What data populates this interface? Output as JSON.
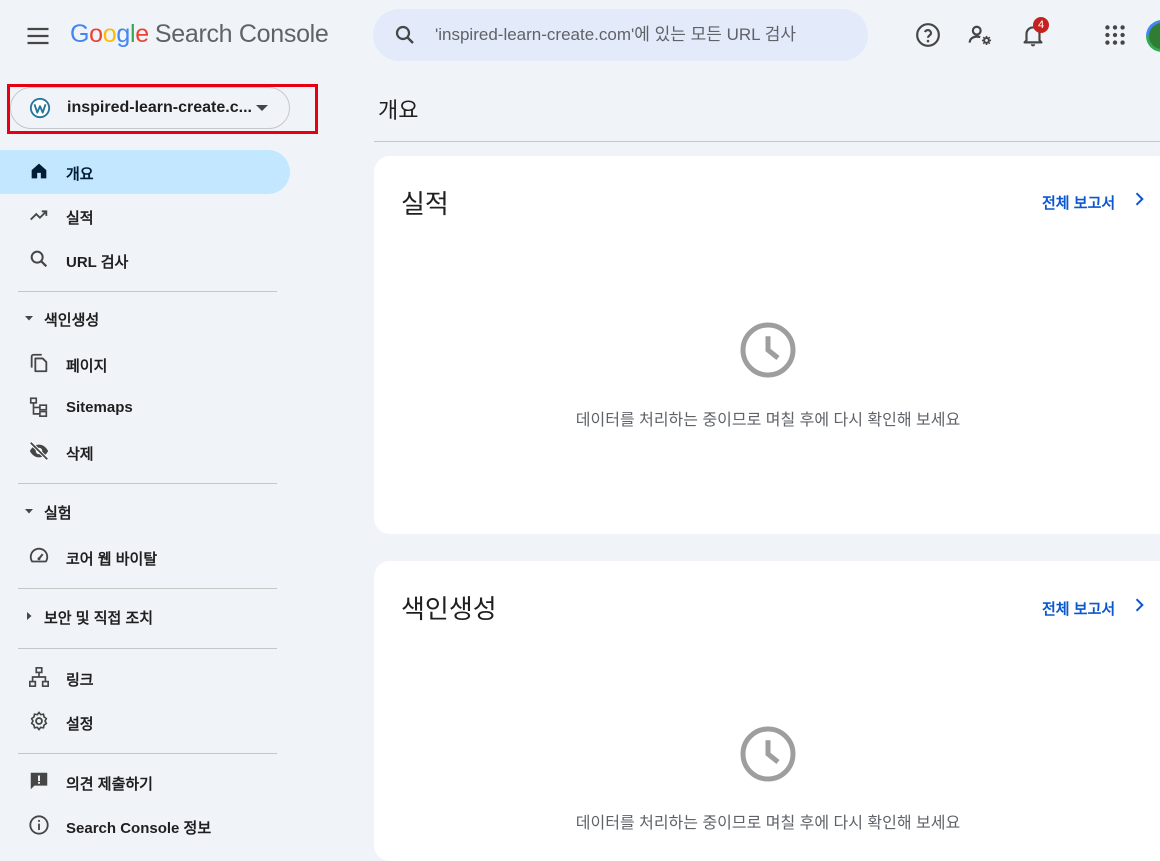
{
  "header": {
    "logo_letters": [
      "G",
      "o",
      "o",
      "g",
      "l",
      "e"
    ],
    "product": "Search Console",
    "search_placeholder": "'inspired-learn-create.com'에 있는 모든 URL 검사",
    "notification_count": "4",
    "icons": [
      "menu-icon",
      "search-icon",
      "help-icon",
      "manage-users-icon",
      "notifications-icon",
      "apps-icon",
      "account-avatar"
    ]
  },
  "property": {
    "name": "inspired-learn-create.c...",
    "icon": "wordpress-icon"
  },
  "sidebar": {
    "items": [
      {
        "label": "개요",
        "icon": "home-icon",
        "active": true
      },
      {
        "label": "실적",
        "icon": "trending-up-icon"
      },
      {
        "label": "URL 검사",
        "icon": "search-icon"
      }
    ],
    "indexing": {
      "label": "색인생성",
      "items": [
        {
          "label": "페이지",
          "icon": "pages-icon"
        },
        {
          "label": "Sitemaps",
          "icon": "sitemap-icon"
        },
        {
          "label": "삭제",
          "icon": "visibility-off-icon"
        }
      ]
    },
    "experience": {
      "label": "실험",
      "items": [
        {
          "label": "코어 웹 바이탈",
          "icon": "speed-icon"
        }
      ]
    },
    "security": {
      "label": "보안 및 직접 조치"
    },
    "misc": [
      {
        "label": "링크",
        "icon": "links-icon"
      },
      {
        "label": "설정",
        "icon": "settings-icon"
      }
    ],
    "footer": [
      {
        "label": "의견 제출하기",
        "icon": "feedback-icon"
      },
      {
        "label": "Search Console 정보",
        "icon": "info-icon"
      }
    ]
  },
  "main": {
    "title": "개요",
    "cards": [
      {
        "title": "실적",
        "link": "전체 보고서",
        "message": "데이터를 처리하는 중이므로 며칠 후에 다시 확인해 보세요"
      },
      {
        "title": "색인생성",
        "link": "전체 보고서",
        "message": "데이터를 처리하는 중이므로 며칠 후에 다시 확인해 보세요"
      }
    ]
  },
  "colors": {
    "background": "#f0f4f9",
    "active_nav": "#c2e7ff",
    "link": "#0b57d0",
    "highlight": "#e60012",
    "badge": "#c5221f"
  }
}
